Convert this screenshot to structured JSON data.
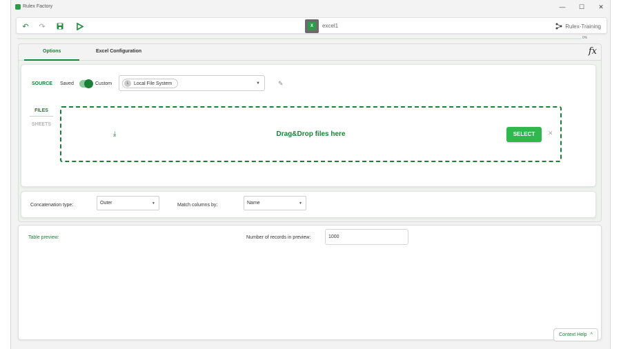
{
  "window": {
    "title": "Rulex Factory",
    "controls": {
      "minimize": "—",
      "maximize": "☐",
      "close": "✕"
    }
  },
  "toolbar": {
    "undo_icon": "↶",
    "redo_icon": "↷",
    "save_icon": "💾",
    "run_icon": "▷",
    "document_name": "excel1",
    "workspace_name": "Rulex-Training",
    "progress_value": 0,
    "progress_label": "0%"
  },
  "tabs": [
    {
      "label": "Options",
      "active": true
    },
    {
      "label": "Excel Configuration",
      "active": false
    }
  ],
  "fx_label": "fx",
  "source": {
    "label": "SOURCE",
    "saved_label": "Saved",
    "custom_label": "Custom",
    "toggle_on": true,
    "selected_source": "Local File System",
    "chip_letter": "L"
  },
  "side_tabs": {
    "files": "FILES",
    "sheets": "SHEETS"
  },
  "dropzone": {
    "text": "Drag&Drop files here",
    "select_button": "SELECT",
    "close_icon": "✕",
    "download_icon": "⤓"
  },
  "concat": {
    "type_label": "Concatenation type:",
    "type_value": "Outer",
    "match_label": "Match columns by:",
    "match_value": "Name"
  },
  "preview": {
    "title": "Table preview:",
    "records_label": "Number of records in preview:",
    "records_value": "1000"
  },
  "context_help": {
    "label": "Context Help",
    "icon": "^"
  },
  "colors": {
    "accent": "#1b7f36",
    "button": "#2eb84e"
  }
}
